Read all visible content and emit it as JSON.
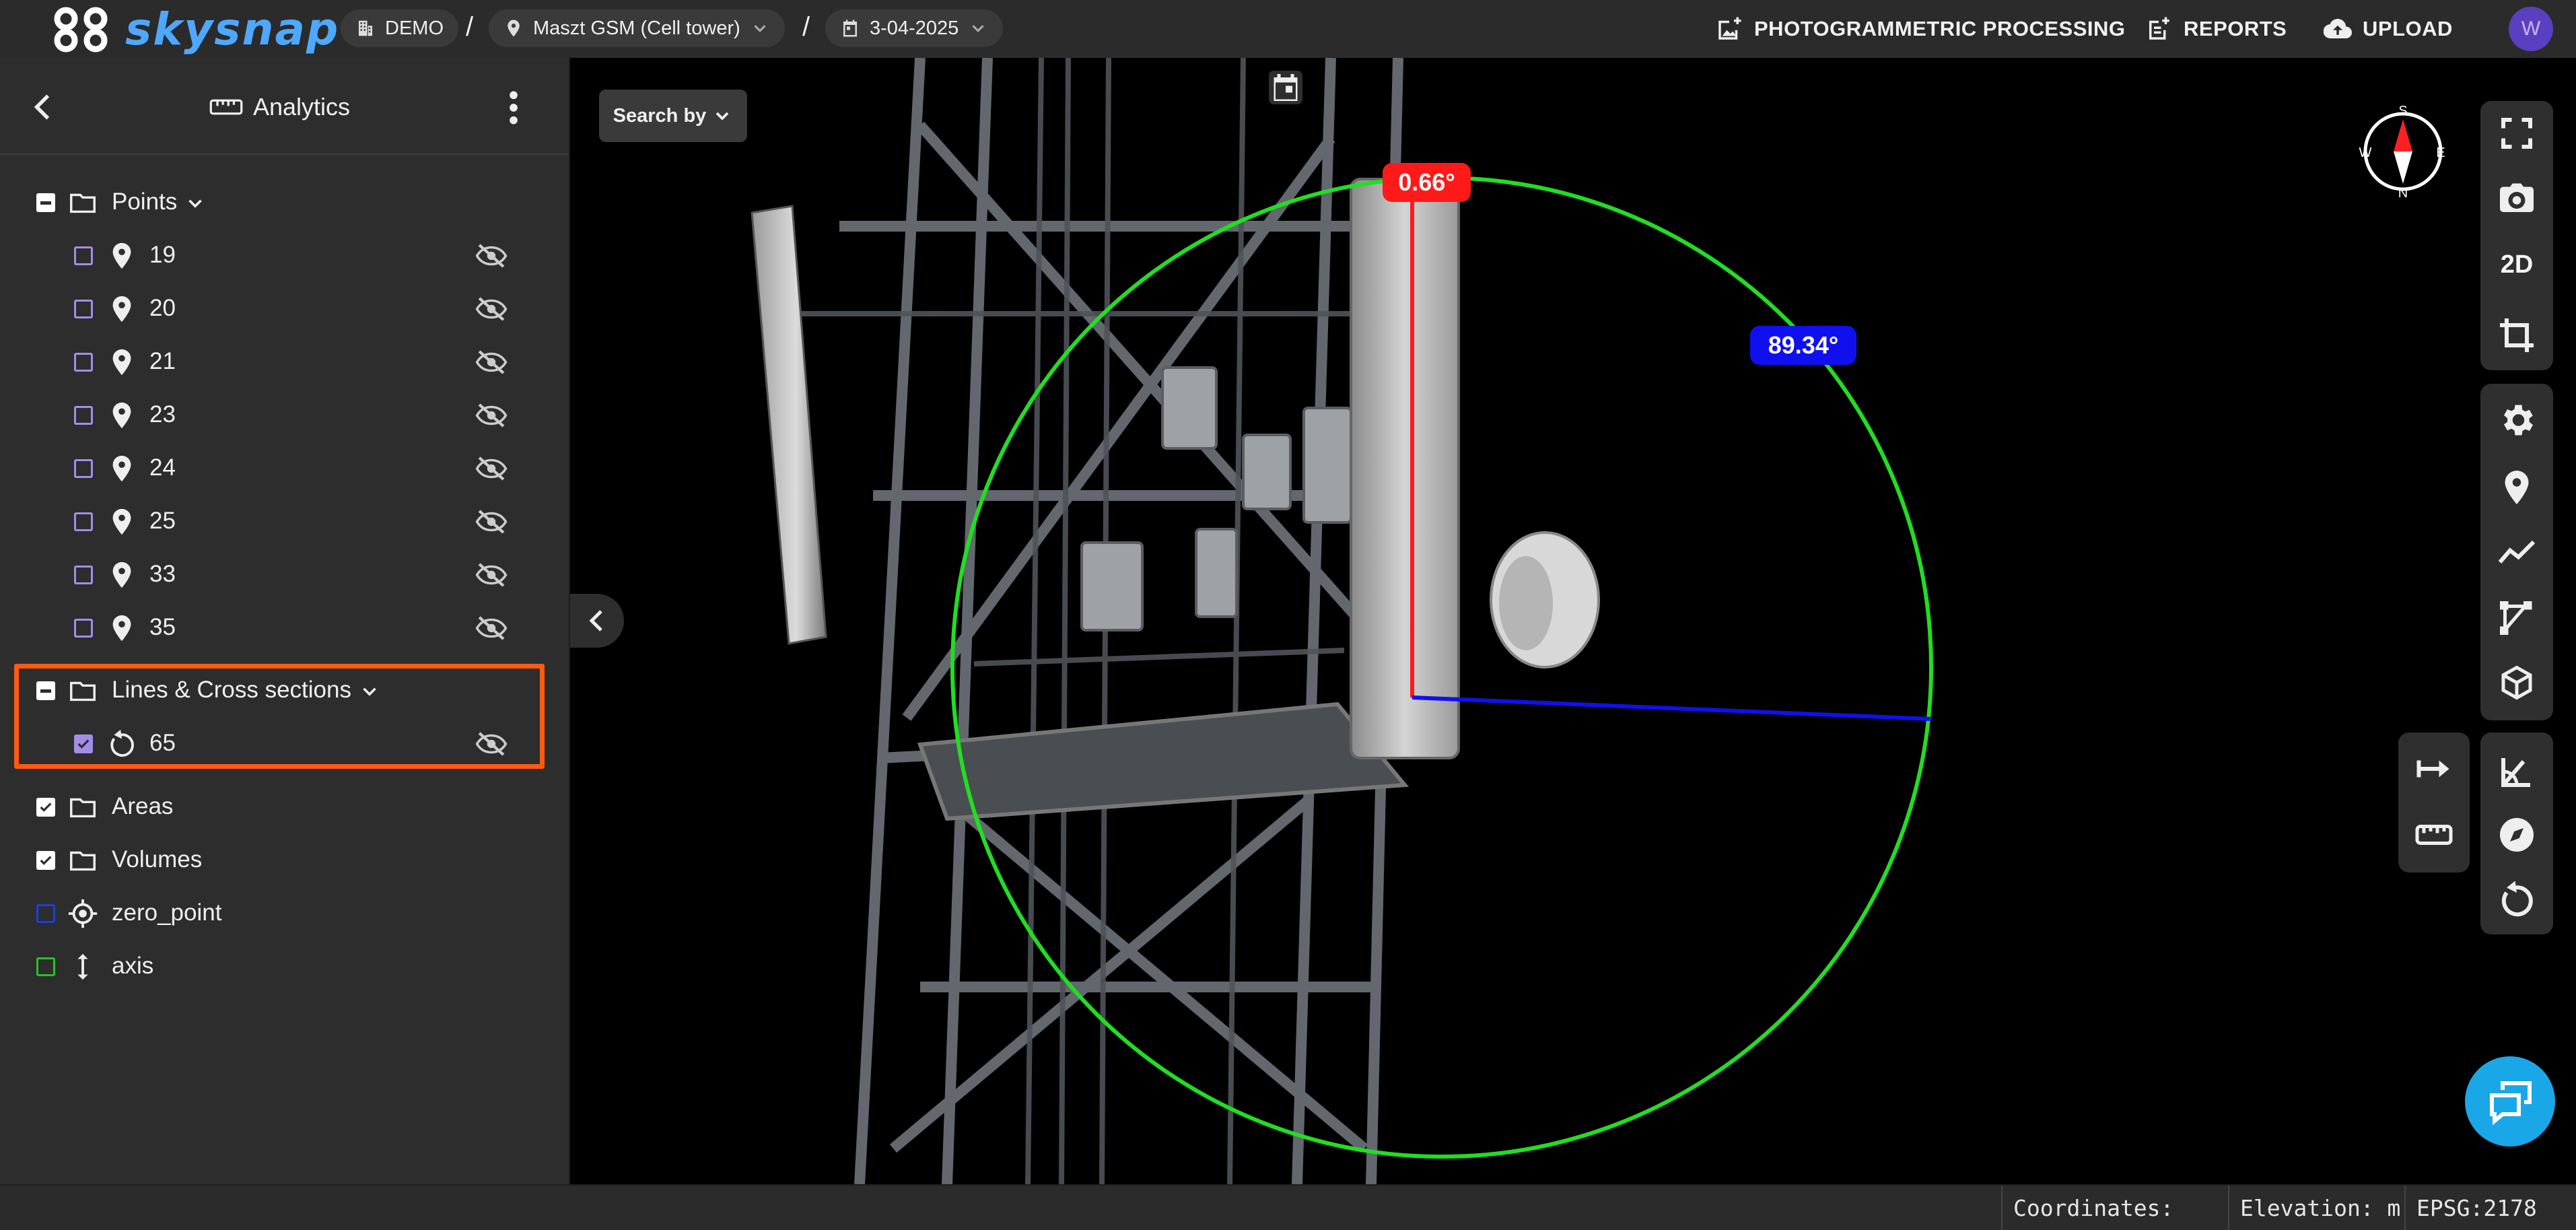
{
  "app": {
    "logo_text": "skysnap"
  },
  "breadcrumb": {
    "workspace": "DEMO",
    "separator": "/",
    "site": "Maszt GSM (Cell tower)",
    "date": "3-04-2025"
  },
  "topnav": {
    "processing": "PHOTOGRAMMETRIC PROCESSING",
    "reports": "REPORTS",
    "upload": "UPLOAD"
  },
  "user": {
    "avatar_initial": "W"
  },
  "panel": {
    "title": "Analytics",
    "groups": {
      "points": {
        "label": "Points",
        "items": [
          "19",
          "20",
          "21",
          "23",
          "24",
          "25",
          "33",
          "35"
        ]
      },
      "lines": {
        "label": "Lines & Cross sections",
        "items": [
          "65"
        ]
      },
      "areas": {
        "label": "Areas"
      },
      "volumes": {
        "label": "Volumes"
      },
      "zero_point": {
        "label": "zero_point"
      },
      "axis": {
        "label": "axis"
      }
    }
  },
  "viewer": {
    "search_by": "Search by",
    "mode_2d": "2D",
    "measurements": {
      "tilt_angle": "0.66°",
      "azimuth_angle": "89.34°"
    },
    "compass_letters": {
      "north": "N",
      "south": "S",
      "east": "E",
      "west": "W"
    }
  },
  "statusbar": {
    "coordinates": "Coordinates:",
    "elevation": "Elevation: m",
    "epsg": "EPSG:2178"
  },
  "colors": {
    "highlight": "#ff5a14",
    "accent_purple": "#a38de8",
    "measure_red": "#ff1a1a",
    "measure_blue": "#1010ee",
    "measure_green": "#22dd22",
    "logo_blue": "#4fa8ff",
    "chat_button": "#1aa7e8"
  }
}
